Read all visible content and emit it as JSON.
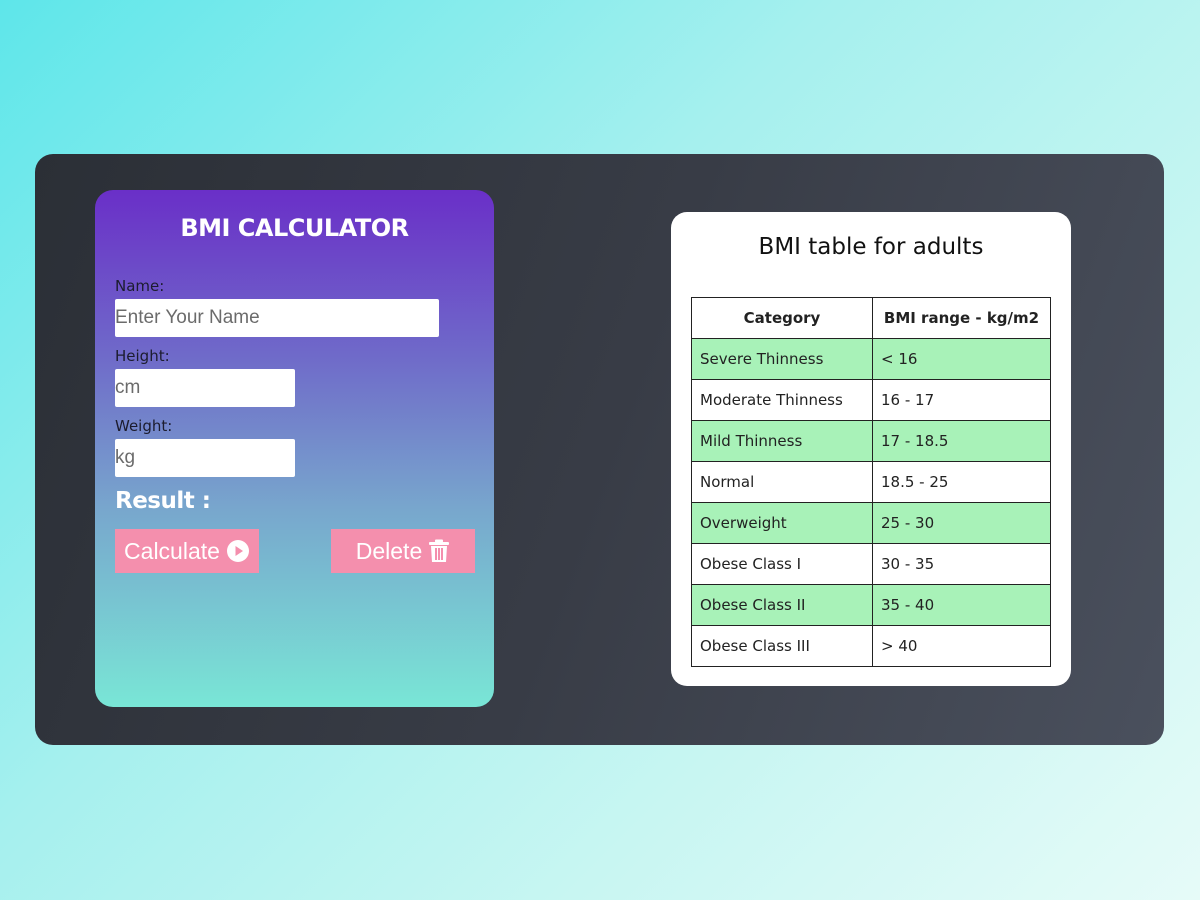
{
  "calculator": {
    "title": "BMI CALCULATOR",
    "name_label": "Name:",
    "name_placeholder": "Enter Your Name",
    "height_label": "Height:",
    "height_placeholder": "cm",
    "weight_label": "Weight:",
    "weight_placeholder": "kg",
    "result_label": "Result :",
    "calculate_label": "Calculate",
    "calculate_icon": "play-circle-icon",
    "delete_label": "Delete",
    "delete_icon": "trash-icon"
  },
  "bmi_table": {
    "title": "BMI table for adults",
    "headers": [
      "Category",
      "BMI range - kg/m2"
    ],
    "rows": [
      {
        "category": "Severe Thinness",
        "range": "< 16"
      },
      {
        "category": "Moderate Thinness",
        "range": "16 - 17"
      },
      {
        "category": "Mild Thinness",
        "range": "17 - 18.5"
      },
      {
        "category": "Normal",
        "range": "18.5 - 25"
      },
      {
        "category": "Overweight",
        "range": "25 - 30"
      },
      {
        "category": "Obese Class I",
        "range": "30 - 35"
      },
      {
        "category": "Obese Class II",
        "range": "35 - 40"
      },
      {
        "category": "Obese Class III",
        "range": "> 40"
      }
    ]
  },
  "colors": {
    "button_bg": "#f48fad",
    "row_highlight": "#a8f2b8",
    "panel_bg": "#383c46"
  }
}
